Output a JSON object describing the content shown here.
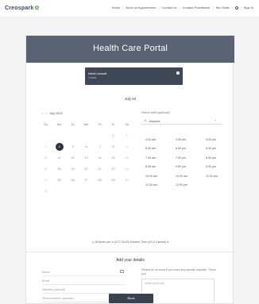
{
  "nav": {
    "logo": "Creospark",
    "links": [
      "Home",
      "Book an Appointment",
      "Contact us",
      "Contact Practitioner",
      "My Chats",
      "Sign in"
    ]
  },
  "banner": {
    "title": "Health Care Portal"
  },
  "service": {
    "name": "Initial consult",
    "duration": "1 hour"
  },
  "selected_date_heading": "July 04",
  "calendar": {
    "month_label": "July 2022",
    "weekdays": [
      "Su",
      "Mo",
      "Tu",
      "We",
      "Th",
      "Fr",
      "Sa"
    ],
    "weeks": [
      [
        "",
        "",
        "",
        "",
        "",
        "1",
        "2"
      ],
      [
        "3",
        "4",
        "5",
        "6",
        "7",
        "8",
        "9"
      ],
      [
        "10",
        "11",
        "12",
        "13",
        "14",
        "15",
        "16"
      ],
      [
        "17",
        "18",
        "19",
        "20",
        "21",
        "22",
        "23"
      ],
      [
        "24",
        "25",
        "26",
        "27",
        "28",
        "29",
        "30"
      ],
      [
        "31",
        "",
        "",
        "",
        "",
        "",
        ""
      ]
    ],
    "selected_day": "4"
  },
  "staff": {
    "label": "Select staff (optional)",
    "value": "Anyone"
  },
  "time_slots": [
    [
      "4:00 am",
      "4:30 am",
      "5:00 pm"
    ],
    [
      "5:30 am",
      "6:00 pm",
      "6:30 pm"
    ],
    [
      "7:00 am",
      "7:30 pm",
      "8:00 pm"
    ],
    [
      "8:30 am",
      "9:00 pm",
      "9:30 pm"
    ],
    [
      "10:00 am",
      "10:30 am",
      "11:00 am"
    ],
    [
      "11:30 am",
      "12:00 pm",
      ""
    ]
  ],
  "timezone_note": "All times are in (UTC-05:00) Eastern Time (US & Canada)",
  "details": {
    "title": "Add your details",
    "fields": [
      "Name",
      "Email",
      "Address (optional)",
      "Phone number (optional)"
    ],
    "special_request_msg": "Please let us know if you have any special requests. Thank you.",
    "notes_placeholder": "Notes (optional)"
  },
  "book_button": "Book"
}
